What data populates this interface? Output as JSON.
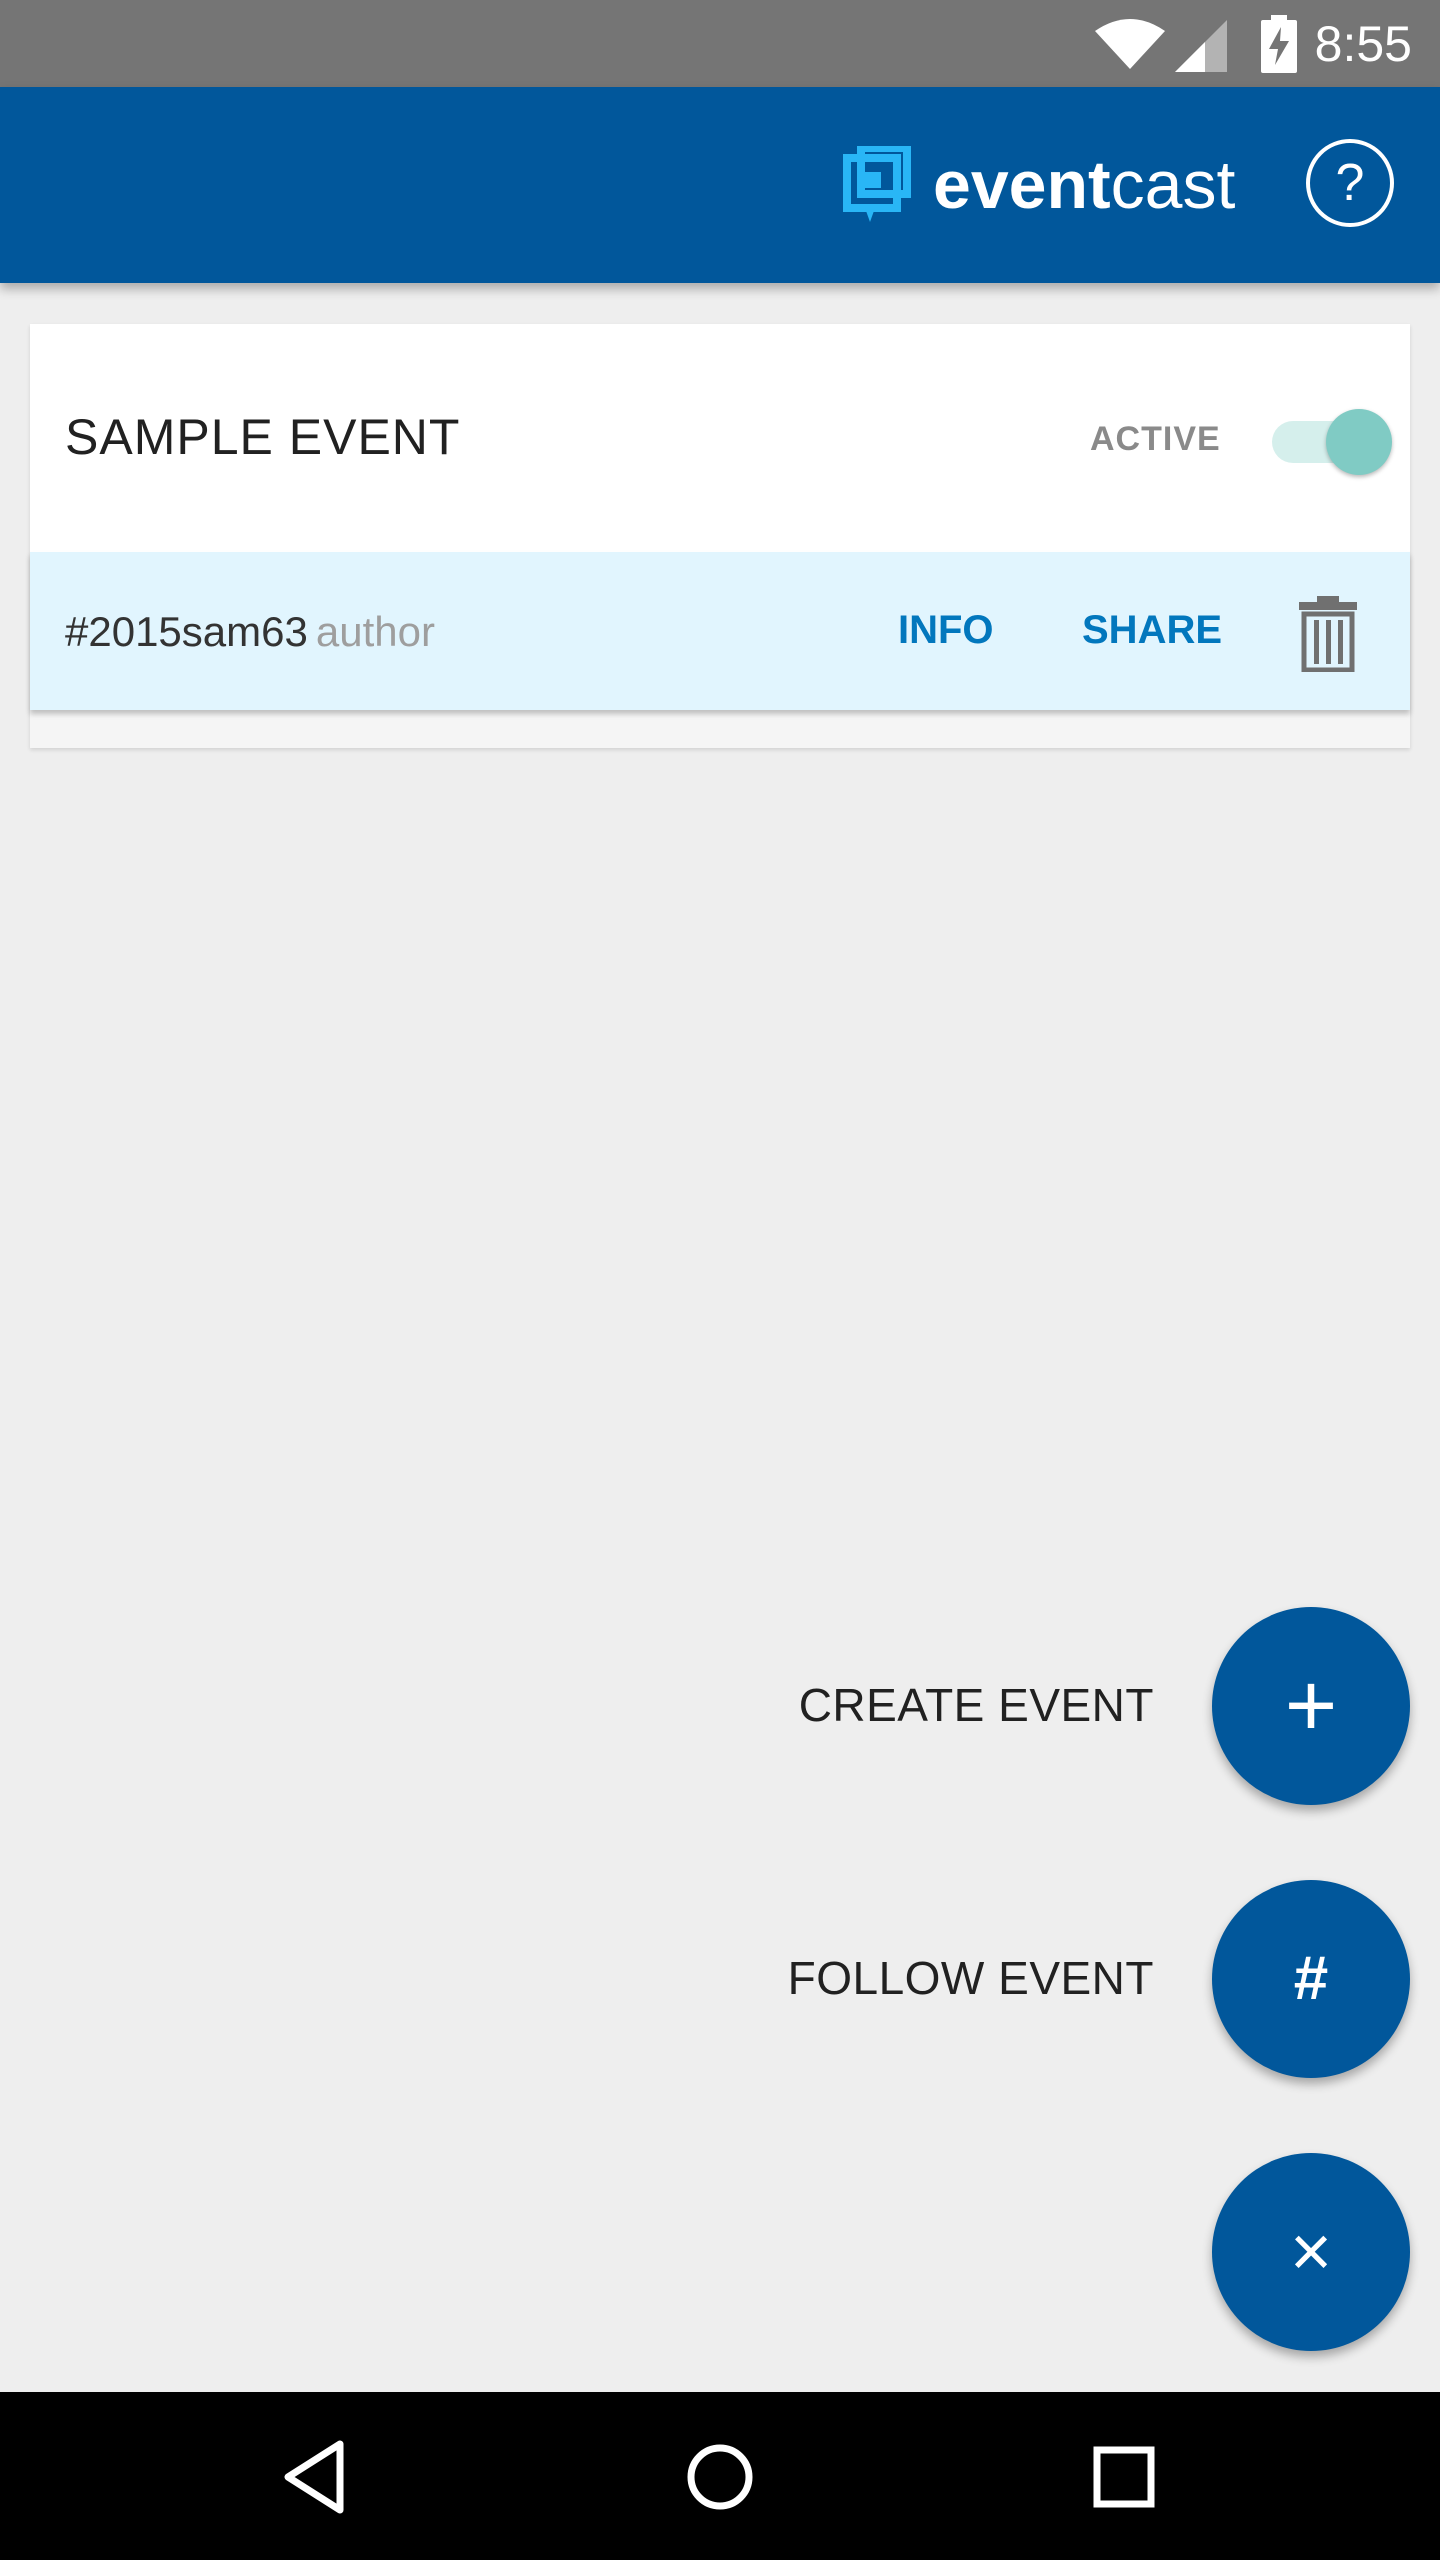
{
  "status_bar": {
    "time": "8:55",
    "icons": [
      "wifi-icon",
      "signal-icon",
      "battery-charging-icon"
    ]
  },
  "app_bar": {
    "logo_text_bold": "event",
    "logo_text_light": "cast",
    "help_label": "?"
  },
  "event_card": {
    "title": "SAMPLE EVENT",
    "status_label": "ACTIVE",
    "toggle_on": true,
    "code": "#2015sam63",
    "role": "author",
    "info_label": "INFO",
    "share_label": "SHARE",
    "delete_icon": "trash-icon"
  },
  "fab_menu": {
    "create_label": "CREATE EVENT",
    "create_icon": "+",
    "follow_label": "FOLLOW EVENT",
    "follow_icon": "#",
    "close_icon": "×"
  },
  "colors": {
    "primary": "#01579b",
    "accent": "#0277bd",
    "toggle": "#80cbc4",
    "row_highlight": "#e1f5fe"
  }
}
